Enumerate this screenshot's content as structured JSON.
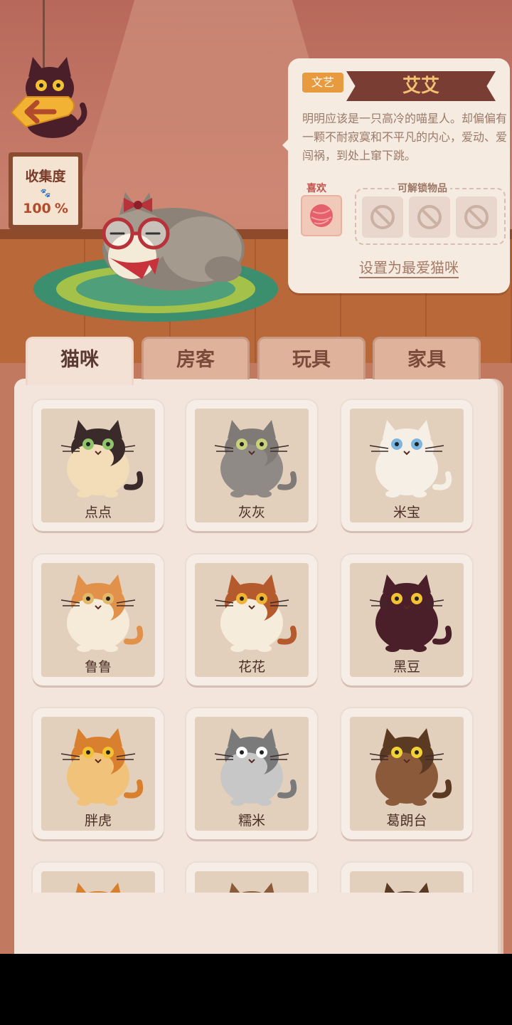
{
  "collection": {
    "title": "收集度",
    "value": "100",
    "unit": "%"
  },
  "info": {
    "genre_tag": "文艺",
    "name": "艾艾",
    "description": "明明应该是一只高冷的喵星人。却偏偏有一颗不耐寂寞和不平凡的内心，爱动、爱闯祸，到处上窜下跳。",
    "like_label": "喜欢",
    "unlock_label": "可解锁物品",
    "favorite_link": "设置为最爱猫咪"
  },
  "tabs": [
    {
      "label": "猫咪",
      "active": true
    },
    {
      "label": "房客",
      "active": false
    },
    {
      "label": "玩具",
      "active": false
    },
    {
      "label": "家具",
      "active": false
    }
  ],
  "cats": [
    {
      "name": "点点",
      "body": "#f2ddb8",
      "top": "#3a2a2a",
      "eyes": "#8fc46a"
    },
    {
      "name": "灰灰",
      "body": "#8f8a86",
      "top": "#7f7a76",
      "eyes": "#c9d27a"
    },
    {
      "name": "米宝",
      "body": "#f5efe6",
      "top": "#f5efe6",
      "eyes": "#7bb6e0"
    },
    {
      "name": "鲁鲁",
      "body": "#f6ead8",
      "top": "#e2914a",
      "eyes": "#e2b86a"
    },
    {
      "name": "花花",
      "body": "#f6ecdc",
      "top": "#b45a2c",
      "eyes": "#f2b233"
    },
    {
      "name": "黑豆",
      "body": "#4a1f2a",
      "top": "#4a1f2a",
      "eyes": "#f2c233"
    },
    {
      "name": "胖虎",
      "body": "#f0c27a",
      "top": "#d9802e",
      "eyes": "#f2c233"
    },
    {
      "name": "糯米",
      "body": "#c7c7c7",
      "top": "#7a7a7a",
      "eyes": "#ffffff"
    },
    {
      "name": "葛朗台",
      "body": "#8a5a3a",
      "top": "#5a3a22",
      "eyes": "#f2d233"
    },
    {
      "name": "",
      "body": "#f0c27a",
      "top": "#d9802e",
      "eyes": "#f2c233"
    },
    {
      "name": "",
      "body": "#e3d0bc",
      "top": "#8a5a3a",
      "eyes": "#f2c233"
    },
    {
      "name": "",
      "body": "#e3d0bc",
      "top": "#5a3a22",
      "eyes": "#f2c233"
    }
  ]
}
